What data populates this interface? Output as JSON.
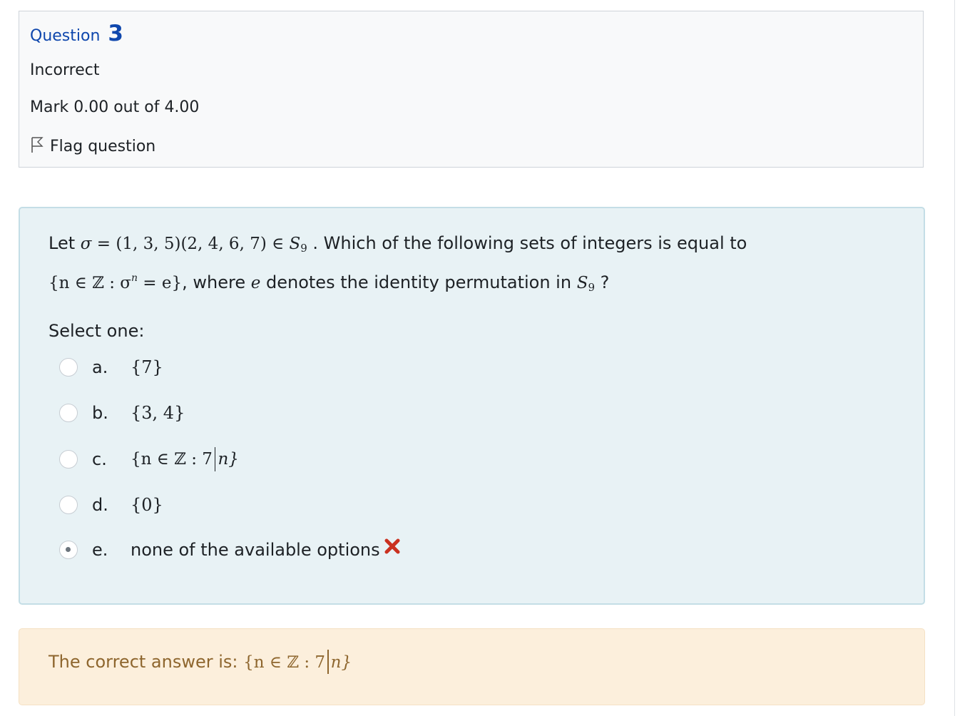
{
  "info": {
    "question_label": "Question",
    "question_number": "3",
    "state": "Incorrect",
    "grade": "Mark 0.00 out of 4.00",
    "flag_label": "Flag question"
  },
  "question": {
    "text_let": "Let ",
    "sigma_symbol": "σ",
    "sigma_def": " = (1, 3, 5)(2, 4, 6, 7) ∈ ",
    "group_S": "S",
    "group_sub": "9",
    "text_which": " . Which of the following sets of integers is equal to",
    "set_open": "{n ∈ ℤ : σ",
    "set_exp": "n",
    "set_close": " = e}",
    "text_where": ", where ",
    "e_symbol": "e",
    "text_denotes": " denotes the identity permutation in ",
    "text_qmark": " ?"
  },
  "prompt": "Select one:",
  "options": [
    {
      "letter": "a.",
      "text": "{7}",
      "checked": false
    },
    {
      "letter": "b.",
      "text": "{3, 4}",
      "checked": false
    },
    {
      "letter": "c.",
      "text_left": "{n ∈ ℤ : 7",
      "text_right": "n}",
      "checked": false
    },
    {
      "letter": "d.",
      "text": "{0}",
      "checked": false
    },
    {
      "letter": "e.",
      "text": "none of the available options",
      "checked": true,
      "status": "incorrect"
    }
  ],
  "feedback": {
    "label": "The correct answer is: ",
    "answer_left": "{n ∈ ℤ : 7",
    "answer_right": "n}"
  },
  "colors": {
    "heading_blue": "#0f47ad",
    "incorrect_red": "#ca3120",
    "feedback_text": "#8e662e",
    "formulation_bg": "#e8f2f5",
    "feedback_bg": "#fcefdc"
  },
  "icons": {
    "flag": "flag-outline-icon",
    "incorrect": "cross-icon"
  }
}
